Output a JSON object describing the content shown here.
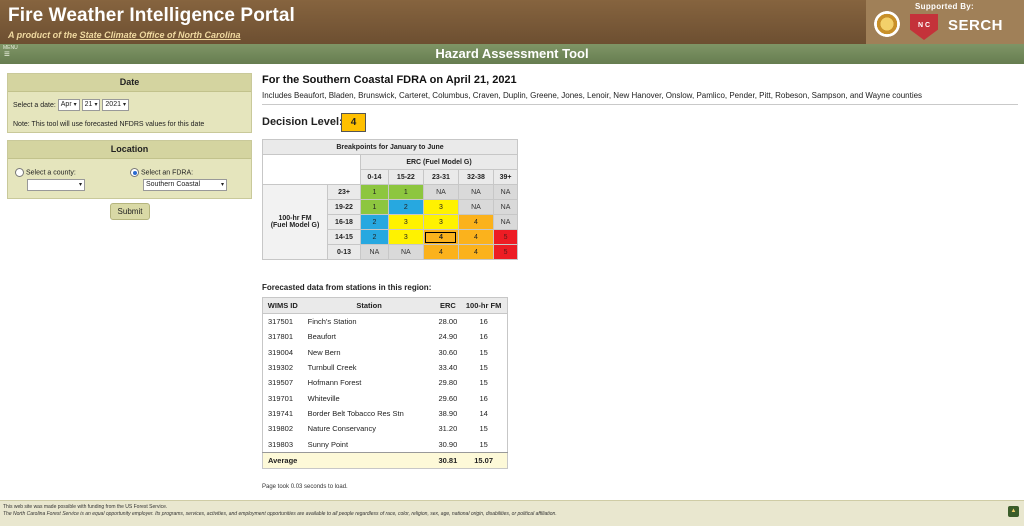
{
  "header": {
    "title": "Fire Weather Intelligence Portal",
    "subtitle_prefix": "A product of the ",
    "subtitle_link": "State Climate Office of North Carolina",
    "supported_by": "Supported By:",
    "serch_label": "SERCH",
    "nc_label": "N C"
  },
  "nav": {
    "menu_label": "MENU",
    "menu_icon": "≡",
    "tool_title": "Hazard Assessment Tool"
  },
  "date_panel": {
    "title": "Date",
    "select_label": "Select a date:",
    "month": "Apr",
    "day": "21",
    "year": "2021",
    "note": "Note: This tool will use forecasted NFDRS values for this date"
  },
  "location_panel": {
    "title": "Location",
    "county_label": "Select a county:",
    "county_value": "",
    "fdra_label": "Select an FDRA:",
    "fdra_value": "Southern Coastal",
    "selected_option": "fdra"
  },
  "submit_label": "Submit",
  "main": {
    "heading": "For the Southern Coastal FDRA on April 21, 2021",
    "includes": "Includes Beaufort, Bladen, Brunswick, Carteret, Columbus, Craven, Duplin, Greene, Jones, Lenoir, New Hanover, Onslow, Pamlico, Pender, Pitt, Robeson, Sampson, and Wayne counties",
    "decision_label": "Decision Level:",
    "decision_value": "4"
  },
  "breakpoints": {
    "title": "Breakpoints for January to June",
    "erc_header": "ERC (Fuel Model G)",
    "erc_cols": [
      "0-14",
      "15-22",
      "23-31",
      "32-38",
      "39+"
    ],
    "fm_header_1": "100-hr FM",
    "fm_header_2": "(Fuel Model G)",
    "rows": [
      {
        "label": "23+",
        "cells": [
          "1",
          "1",
          "NA",
          "NA",
          "NA"
        ],
        "colors": [
          "green",
          "green",
          "na",
          "na",
          "na"
        ]
      },
      {
        "label": "19-22",
        "cells": [
          "1",
          "2",
          "3",
          "NA",
          "NA"
        ],
        "colors": [
          "green",
          "blue",
          "yellow",
          "na",
          "na"
        ]
      },
      {
        "label": "16-18",
        "cells": [
          "2",
          "3",
          "3",
          "4",
          "NA"
        ],
        "colors": [
          "blue",
          "yellow",
          "yellow",
          "orange",
          "na"
        ]
      },
      {
        "label": "14-15",
        "cells": [
          "2",
          "3",
          "4",
          "4",
          "5"
        ],
        "colors": [
          "blue",
          "yellow",
          "orange",
          "orange",
          "red"
        ]
      },
      {
        "label": "0-13",
        "cells": [
          "NA",
          "NA",
          "4",
          "4",
          "5"
        ],
        "colors": [
          "na",
          "na",
          "orange",
          "orange",
          "red"
        ]
      }
    ],
    "selected_row": 3,
    "selected_col": 2
  },
  "stations": {
    "title": "Forecasted data from stations in this region:",
    "headers": [
      "WIMS ID",
      "Station",
      "ERC",
      "100-hr FM"
    ],
    "rows": [
      [
        "317501",
        "Finch's Station",
        "28.00",
        "16"
      ],
      [
        "317801",
        "Beaufort",
        "24.90",
        "16"
      ],
      [
        "319004",
        "New Bern",
        "30.60",
        "15"
      ],
      [
        "319302",
        "Turnbull Creek",
        "33.40",
        "15"
      ],
      [
        "319507",
        "Hofmann Forest",
        "29.80",
        "15"
      ],
      [
        "319701",
        "Whiteville",
        "29.60",
        "16"
      ],
      [
        "319741",
        "Border Belt Tobacco Res Stn",
        "38.90",
        "14"
      ],
      [
        "319802",
        "Nature Conservancy",
        "31.20",
        "15"
      ],
      [
        "319803",
        "Sunny Point",
        "30.90",
        "15"
      ]
    ],
    "average": [
      "Average",
      "30.81",
      "15.07"
    ]
  },
  "load_note": "Page took 0.03 seconds to load.",
  "footer": {
    "line1": "This web site was made possible with funding from the US Forest Service.",
    "line2": "The North Carolina Forest Service is an equal opportunity employer. Its programs, services, activities, and employment opportunities are available to all people regardless of race, color, religion, sex, age, national origin, disabilities, or political affiliation."
  }
}
